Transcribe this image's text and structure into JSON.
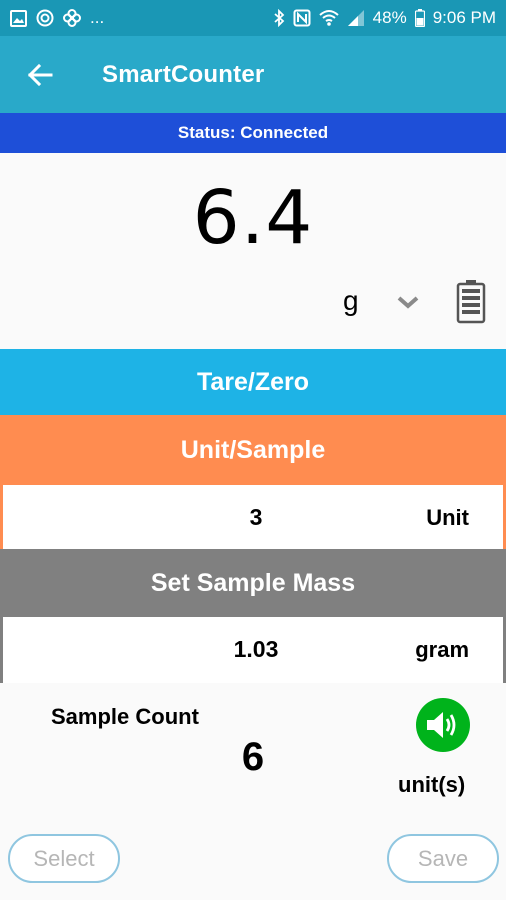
{
  "status_bar": {
    "left_icons": [
      "image-icon",
      "target-icon",
      "pinwheel-icon"
    ],
    "overflow": "...",
    "battery_percent": "48%",
    "time": "9:06 PM"
  },
  "app_bar": {
    "title": "SmartCounter"
  },
  "connection": {
    "status": "Status: Connected"
  },
  "scale": {
    "reading": "6.4",
    "unit": "g"
  },
  "buttons": {
    "tare": "Tare/Zero",
    "unit_sample": "Unit/Sample",
    "set_sample_mass": "Set Sample Mass",
    "select": "Select",
    "save": "Save"
  },
  "unit_sample_row": {
    "value": "3",
    "unit": "Unit"
  },
  "sample_mass_row": {
    "value": "1.03",
    "unit": "gram"
  },
  "sample_count": {
    "label": "Sample Count",
    "value": "6",
    "unit": "unit(s)"
  },
  "colors": {
    "status_bar": "#1a97b5",
    "app_bar": "#29a9c9",
    "status_strip": "#1e4fd8",
    "tare": "#1eb3e6",
    "unit_sample": "#ff8c50",
    "set_mass": "#808080",
    "speaker": "#00b31b"
  }
}
